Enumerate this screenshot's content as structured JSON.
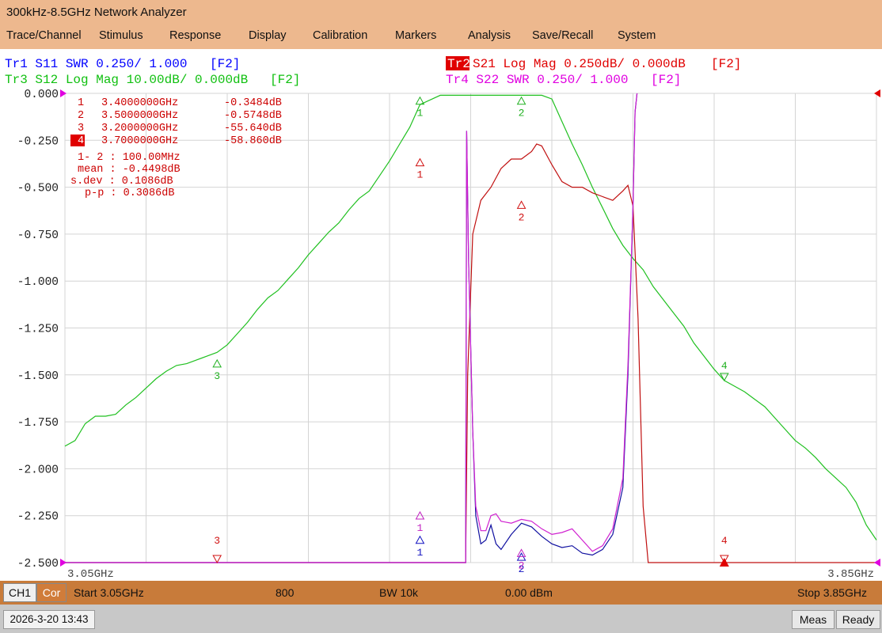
{
  "window": {
    "title": "300kHz-8.5GHz Network Analyzer"
  },
  "menu": {
    "items": [
      "Trace/Channel",
      "Stimulus",
      "Response",
      "Display",
      "Calibration",
      "Markers",
      "Analysis",
      "Save/Recall",
      "System"
    ]
  },
  "traces": {
    "tr1": {
      "label": "Tr1 S11 SWR 0.250/ 1.000",
      "tag": "[F2]",
      "color": "#0000ff"
    },
    "tr2": {
      "label": "Tr2",
      "rest": "S21 Log Mag 0.250dB/ 0.000dB",
      "tag": "[F2]",
      "color": "#e00000"
    },
    "tr3": {
      "label": "Tr3 S12 Log Mag 10.00dB/ 0.000dB",
      "tag": "[F2]",
      "color": "#10c010"
    },
    "tr4": {
      "label": "Tr4 S22 SWR 0.250/ 1.000",
      "tag": "[F2]",
      "color": "#e000e0"
    }
  },
  "marker_table": {
    "rows": [
      {
        "num": "1",
        "freq": "3.4000000GHz",
        "value": "-0.3484dB"
      },
      {
        "num": "2",
        "freq": "3.5000000GHz",
        "value": "-0.5748dB"
      },
      {
        "num": "3",
        "freq": "3.2000000GHz",
        "value": "-55.640dB"
      },
      {
        "num": "4",
        "freq": "3.7000000GHz",
        "value": "-58.860dB"
      }
    ],
    "stats": [
      "1- 2 : 100.00MHz",
      "mean : -0.4498dB",
      "s.dev : 0.1086dB",
      "p-p : 0.3086dB"
    ]
  },
  "chart_data": {
    "type": "line",
    "x_unit": "GHz",
    "xlim": [
      3.05,
      3.85
    ],
    "ylim": [
      -2.5,
      0.0
    ],
    "grid": true,
    "y_ticks": [
      "0.000",
      "-0.250",
      "-0.500",
      "-0.750",
      "-1.000",
      "-1.250",
      "-1.500",
      "-1.750",
      "-2.000",
      "-2.250",
      "-2.500"
    ],
    "x_start_label": "3.05GHz",
    "x_stop_label": "3.85GHz",
    "series": [
      {
        "name": "Tr1 S11 SWR",
        "color": "#1010a0",
        "points": [
          [
            3.05,
            -2.5
          ],
          [
            3.445,
            -2.5
          ],
          [
            3.446,
            -0.2
          ],
          [
            3.448,
            -0.9
          ],
          [
            3.452,
            -1.8
          ],
          [
            3.455,
            -2.25
          ],
          [
            3.46,
            -2.4
          ],
          [
            3.465,
            -2.38
          ],
          [
            3.47,
            -2.3
          ],
          [
            3.475,
            -2.4
          ],
          [
            3.48,
            -2.43
          ],
          [
            3.49,
            -2.35
          ],
          [
            3.5,
            -2.29
          ],
          [
            3.51,
            -2.31
          ],
          [
            3.52,
            -2.36
          ],
          [
            3.53,
            -2.4
          ],
          [
            3.54,
            -2.42
          ],
          [
            3.55,
            -2.41
          ],
          [
            3.56,
            -2.45
          ],
          [
            3.57,
            -2.46
          ],
          [
            3.58,
            -2.43
          ],
          [
            3.59,
            -2.35
          ],
          [
            3.6,
            -2.1
          ],
          [
            3.605,
            -1.5
          ],
          [
            3.61,
            -0.6
          ],
          [
            3.612,
            -0.1
          ],
          [
            3.614,
            0.0
          ]
        ]
      },
      {
        "name": "Tr2 S21 Log Mag",
        "color": "#c01010",
        "points": [
          [
            3.05,
            -2.5
          ],
          [
            3.445,
            -2.5
          ],
          [
            3.447,
            -1.5
          ],
          [
            3.452,
            -0.75
          ],
          [
            3.46,
            -0.57
          ],
          [
            3.47,
            -0.5
          ],
          [
            3.48,
            -0.4
          ],
          [
            3.49,
            -0.35
          ],
          [
            3.5,
            -0.35
          ],
          [
            3.51,
            -0.31
          ],
          [
            3.515,
            -0.27
          ],
          [
            3.52,
            -0.28
          ],
          [
            3.53,
            -0.38
          ],
          [
            3.54,
            -0.47
          ],
          [
            3.55,
            -0.5
          ],
          [
            3.56,
            -0.5
          ],
          [
            3.57,
            -0.53
          ],
          [
            3.58,
            -0.55
          ],
          [
            3.59,
            -0.57
          ],
          [
            3.6,
            -0.52
          ],
          [
            3.605,
            -0.49
          ],
          [
            3.61,
            -0.6
          ],
          [
            3.615,
            -1.2
          ],
          [
            3.62,
            -2.2
          ],
          [
            3.625,
            -2.5
          ],
          [
            3.85,
            -2.5
          ]
        ]
      },
      {
        "name": "Tr3 S12 Log Mag",
        "color": "#20c020",
        "points": [
          [
            3.05,
            -1.88
          ],
          [
            3.06,
            -1.85
          ],
          [
            3.07,
            -1.76
          ],
          [
            3.08,
            -1.72
          ],
          [
            3.09,
            -1.72
          ],
          [
            3.1,
            -1.71
          ],
          [
            3.11,
            -1.66
          ],
          [
            3.12,
            -1.62
          ],
          [
            3.13,
            -1.57
          ],
          [
            3.14,
            -1.52
          ],
          [
            3.15,
            -1.48
          ],
          [
            3.16,
            -1.45
          ],
          [
            3.17,
            -1.44
          ],
          [
            3.18,
            -1.42
          ],
          [
            3.19,
            -1.4
          ],
          [
            3.2,
            -1.38
          ],
          [
            3.21,
            -1.34
          ],
          [
            3.22,
            -1.28
          ],
          [
            3.23,
            -1.22
          ],
          [
            3.24,
            -1.15
          ],
          [
            3.25,
            -1.09
          ],
          [
            3.26,
            -1.05
          ],
          [
            3.27,
            -0.99
          ],
          [
            3.28,
            -0.93
          ],
          [
            3.29,
            -0.86
          ],
          [
            3.3,
            -0.8
          ],
          [
            3.31,
            -0.74
          ],
          [
            3.32,
            -0.69
          ],
          [
            3.33,
            -0.62
          ],
          [
            3.34,
            -0.56
          ],
          [
            3.35,
            -0.52
          ],
          [
            3.36,
            -0.44
          ],
          [
            3.37,
            -0.36
          ],
          [
            3.38,
            -0.27
          ],
          [
            3.39,
            -0.18
          ],
          [
            3.4,
            -0.06
          ],
          [
            3.42,
            -0.01
          ],
          [
            3.44,
            -0.01
          ],
          [
            3.46,
            -0.01
          ],
          [
            3.48,
            -0.01
          ],
          [
            3.5,
            -0.01
          ],
          [
            3.52,
            -0.01
          ],
          [
            3.53,
            -0.03
          ],
          [
            3.54,
            -0.15
          ],
          [
            3.55,
            -0.27
          ],
          [
            3.56,
            -0.38
          ],
          [
            3.57,
            -0.5
          ],
          [
            3.58,
            -0.61
          ],
          [
            3.59,
            -0.72
          ],
          [
            3.6,
            -0.81
          ],
          [
            3.61,
            -0.88
          ],
          [
            3.62,
            -0.94
          ],
          [
            3.63,
            -1.03
          ],
          [
            3.64,
            -1.1
          ],
          [
            3.65,
            -1.17
          ],
          [
            3.66,
            -1.24
          ],
          [
            3.67,
            -1.33
          ],
          [
            3.68,
            -1.4
          ],
          [
            3.69,
            -1.47
          ],
          [
            3.7,
            -1.53
          ],
          [
            3.71,
            -1.56
          ],
          [
            3.72,
            -1.59
          ],
          [
            3.73,
            -1.63
          ],
          [
            3.74,
            -1.67
          ],
          [
            3.75,
            -1.73
          ],
          [
            3.76,
            -1.79
          ],
          [
            3.77,
            -1.85
          ],
          [
            3.78,
            -1.89
          ],
          [
            3.79,
            -1.94
          ],
          [
            3.8,
            -2.0
          ],
          [
            3.81,
            -2.05
          ],
          [
            3.82,
            -2.1
          ],
          [
            3.83,
            -2.18
          ],
          [
            3.84,
            -2.3
          ],
          [
            3.85,
            -2.38
          ]
        ]
      },
      {
        "name": "Tr4 S22 SWR",
        "color": "#d020d0",
        "points": [
          [
            3.05,
            -2.5
          ],
          [
            3.445,
            -2.5
          ],
          [
            3.446,
            -0.2
          ],
          [
            3.448,
            -0.9
          ],
          [
            3.452,
            -1.8
          ],
          [
            3.455,
            -2.2
          ],
          [
            3.46,
            -2.33
          ],
          [
            3.465,
            -2.33
          ],
          [
            3.47,
            -2.25
          ],
          [
            3.475,
            -2.24
          ],
          [
            3.48,
            -2.28
          ],
          [
            3.49,
            -2.29
          ],
          [
            3.5,
            -2.27
          ],
          [
            3.51,
            -2.28
          ],
          [
            3.52,
            -2.32
          ],
          [
            3.53,
            -2.35
          ],
          [
            3.54,
            -2.34
          ],
          [
            3.55,
            -2.32
          ],
          [
            3.56,
            -2.38
          ],
          [
            3.57,
            -2.44
          ],
          [
            3.58,
            -2.41
          ],
          [
            3.59,
            -2.32
          ],
          [
            3.6,
            -2.05
          ],
          [
            3.605,
            -1.45
          ],
          [
            3.61,
            -0.6
          ],
          [
            3.612,
            -0.1
          ],
          [
            3.614,
            0.0
          ]
        ]
      }
    ],
    "markers": [
      {
        "trace": "Tr2",
        "num": "1",
        "x": 3.4,
        "y": -0.3484
      },
      {
        "trace": "Tr2",
        "num": "2",
        "x": 3.5,
        "y": -0.5748
      },
      {
        "trace": "Tr3",
        "num": "1",
        "x": 3.4,
        "y": -0.02
      },
      {
        "trace": "Tr3",
        "num": "2",
        "x": 3.5,
        "y": -0.02
      },
      {
        "trace": "Tr3",
        "num": "3",
        "x": 3.2,
        "y": -1.42
      },
      {
        "trace": "Tr3",
        "num": "4",
        "x": 3.7,
        "y": -1.53
      },
      {
        "trace": "Tr1",
        "num": "1",
        "x": 3.4,
        "y": -2.36
      },
      {
        "trace": "Tr1",
        "num": "2",
        "x": 3.5,
        "y": -2.45
      },
      {
        "trace": "Tr4",
        "num": "1",
        "x": 3.4,
        "y": -2.23
      },
      {
        "trace": "Tr4",
        "num": "2",
        "x": 3.5,
        "y": -2.43
      },
      {
        "trace": "Tr2",
        "num": "3",
        "x": 3.2,
        "y": -2.5
      },
      {
        "trace": "Tr2",
        "num": "4",
        "x": 3.7,
        "y": -2.5
      }
    ]
  },
  "status": {
    "channel": "CH1",
    "correction": "Cor",
    "start": "Start 3.05GHz",
    "points": "800",
    "bandwidth": "BW 10k",
    "power": "0.00 dBm",
    "stop": "Stop 3.85GHz"
  },
  "bottom": {
    "datetime": "2026-3-20 13:43",
    "meas": "Meas",
    "ready": "Ready"
  }
}
